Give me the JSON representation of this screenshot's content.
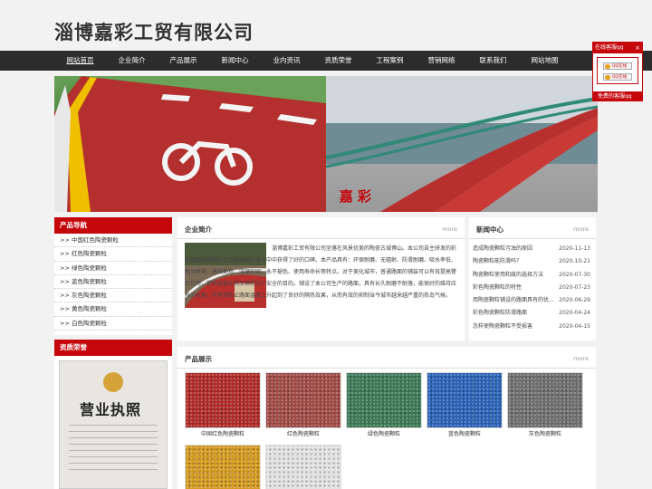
{
  "site": {
    "title": "淄博嘉彩工贸有限公司"
  },
  "nav": {
    "items": [
      "网站首页",
      "企业简介",
      "产品展示",
      "新闻中心",
      "业内资讯",
      "资质荣誉",
      "工程案例",
      "营销网络",
      "联系我们",
      "网站地图"
    ]
  },
  "banner": {
    "caption": "嘉  彩"
  },
  "sidebar": {
    "product_nav": {
      "title": "产品导航",
      "items": [
        ">> 中国红色陶瓷颗粒",
        ">> 红色陶瓷颗粒",
        ">> 绿色陶瓷颗粒",
        ">> 蓝色陶瓷颗粒",
        ">> 灰色陶瓷颗粒",
        ">> 黄色陶瓷颗粒",
        ">> 白色陶瓷颗粒"
      ]
    },
    "certs": {
      "title": "资质荣誉",
      "license_text": "营业执照"
    }
  },
  "about": {
    "title": "企业简介",
    "more": "more",
    "text": "淄博嘉彩工贸有限公司坐落在风景优美的陶瓷古城博山。本公司自主研发的彩色路面陶瓷颗粒在色路面材料施工中中获得了好的口碑。本产品具有：环保耐磨、无辐射、防滑耐磨、吸水率低、色泽鲜艳、高档美观、坚硬牢固、永不褪色、使用寿命长等特点。对于美化城市，普通路面的铺装可以有效提高警示作用，提前减速达到车辆和行人安全的目的。铺设了本公司生产的路面，具有长久耐磨不耐落，能很好的维持应有的机能，并有效防止路面温度上升起到了良好的隔热效果，从而有效的抑制当今城市越来越严重的热岛气候。"
  },
  "news": {
    "title": "新闻中心",
    "more": "more",
    "items": [
      {
        "title": "造成陶瓷颗粒污浊的原因",
        "date": "2020-11-13"
      },
      {
        "title": "陶瓷颗粒能防滑吗？",
        "date": "2020-10-21"
      },
      {
        "title": "陶瓷颗粒使用和废的选择方法",
        "date": "2020-07-30"
      },
      {
        "title": "彩色陶瓷颗粒的特性",
        "date": "2020-07-23"
      },
      {
        "title": "用陶瓷颗粒铺设的路面具有的优...",
        "date": "2020-06-29"
      },
      {
        "title": "彩色陶瓷颗粒防滑路面",
        "date": "2020-04-24"
      },
      {
        "title": "怎样使陶瓷颗粒不受损害",
        "date": "2020-04-15"
      }
    ]
  },
  "products": {
    "title": "产品展示",
    "more": "more",
    "items": [
      {
        "name": "中国红色陶瓷颗粒",
        "color": "#b02a27"
      },
      {
        "name": "红色陶瓷颗粒",
        "color": "#a04a45"
      },
      {
        "name": "绿色陶瓷颗粒",
        "color": "#3c7a56"
      },
      {
        "name": "蓝色陶瓷颗粒",
        "color": "#2a62b8"
      },
      {
        "name": "灰色陶瓷颗粒",
        "color": "#6f6f6f"
      },
      {
        "name": "",
        "color": "#d49a1e"
      },
      {
        "name": "",
        "color": "#e2e2e2"
      }
    ]
  },
  "qq": {
    "title": "在线客服qq",
    "close": "×",
    "btn1": "QQ在线",
    "btn2": "QQ在线",
    "footer": "免费的客服qq"
  },
  "colors": {
    "brand_red": "#c5070c",
    "nav_bg": "#2c2c2c"
  }
}
